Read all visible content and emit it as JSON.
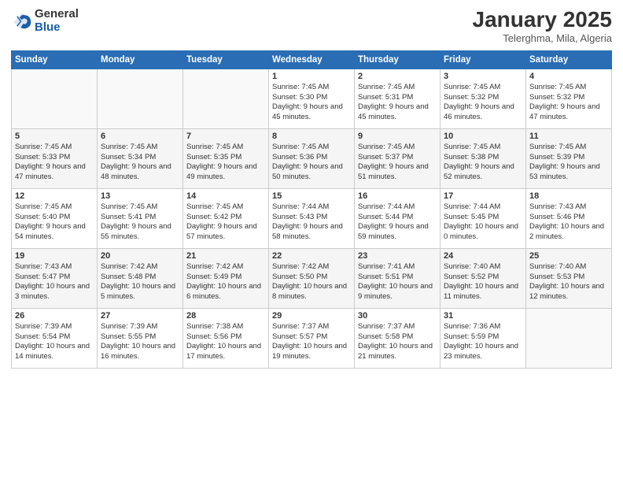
{
  "header": {
    "logo_general": "General",
    "logo_blue": "Blue",
    "title": "January 2025",
    "subtitle": "Telerghma, Mila, Algeria"
  },
  "days_of_week": [
    "Sunday",
    "Monday",
    "Tuesday",
    "Wednesday",
    "Thursday",
    "Friday",
    "Saturday"
  ],
  "weeks": [
    [
      {
        "day": "",
        "info": ""
      },
      {
        "day": "",
        "info": ""
      },
      {
        "day": "",
        "info": ""
      },
      {
        "day": "1",
        "info": "Sunrise: 7:45 AM\nSunset: 5:30 PM\nDaylight: 9 hours and 45 minutes."
      },
      {
        "day": "2",
        "info": "Sunrise: 7:45 AM\nSunset: 5:31 PM\nDaylight: 9 hours and 45 minutes."
      },
      {
        "day": "3",
        "info": "Sunrise: 7:45 AM\nSunset: 5:32 PM\nDaylight: 9 hours and 46 minutes."
      },
      {
        "day": "4",
        "info": "Sunrise: 7:45 AM\nSunset: 5:32 PM\nDaylight: 9 hours and 47 minutes."
      }
    ],
    [
      {
        "day": "5",
        "info": "Sunrise: 7:45 AM\nSunset: 5:33 PM\nDaylight: 9 hours and 47 minutes."
      },
      {
        "day": "6",
        "info": "Sunrise: 7:45 AM\nSunset: 5:34 PM\nDaylight: 9 hours and 48 minutes."
      },
      {
        "day": "7",
        "info": "Sunrise: 7:45 AM\nSunset: 5:35 PM\nDaylight: 9 hours and 49 minutes."
      },
      {
        "day": "8",
        "info": "Sunrise: 7:45 AM\nSunset: 5:36 PM\nDaylight: 9 hours and 50 minutes."
      },
      {
        "day": "9",
        "info": "Sunrise: 7:45 AM\nSunset: 5:37 PM\nDaylight: 9 hours and 51 minutes."
      },
      {
        "day": "10",
        "info": "Sunrise: 7:45 AM\nSunset: 5:38 PM\nDaylight: 9 hours and 52 minutes."
      },
      {
        "day": "11",
        "info": "Sunrise: 7:45 AM\nSunset: 5:39 PM\nDaylight: 9 hours and 53 minutes."
      }
    ],
    [
      {
        "day": "12",
        "info": "Sunrise: 7:45 AM\nSunset: 5:40 PM\nDaylight: 9 hours and 54 minutes."
      },
      {
        "day": "13",
        "info": "Sunrise: 7:45 AM\nSunset: 5:41 PM\nDaylight: 9 hours and 55 minutes."
      },
      {
        "day": "14",
        "info": "Sunrise: 7:45 AM\nSunset: 5:42 PM\nDaylight: 9 hours and 57 minutes."
      },
      {
        "day": "15",
        "info": "Sunrise: 7:44 AM\nSunset: 5:43 PM\nDaylight: 9 hours and 58 minutes."
      },
      {
        "day": "16",
        "info": "Sunrise: 7:44 AM\nSunset: 5:44 PM\nDaylight: 9 hours and 59 minutes."
      },
      {
        "day": "17",
        "info": "Sunrise: 7:44 AM\nSunset: 5:45 PM\nDaylight: 10 hours and 0 minutes."
      },
      {
        "day": "18",
        "info": "Sunrise: 7:43 AM\nSunset: 5:46 PM\nDaylight: 10 hours and 2 minutes."
      }
    ],
    [
      {
        "day": "19",
        "info": "Sunrise: 7:43 AM\nSunset: 5:47 PM\nDaylight: 10 hours and 3 minutes."
      },
      {
        "day": "20",
        "info": "Sunrise: 7:42 AM\nSunset: 5:48 PM\nDaylight: 10 hours and 5 minutes."
      },
      {
        "day": "21",
        "info": "Sunrise: 7:42 AM\nSunset: 5:49 PM\nDaylight: 10 hours and 6 minutes."
      },
      {
        "day": "22",
        "info": "Sunrise: 7:42 AM\nSunset: 5:50 PM\nDaylight: 10 hours and 8 minutes."
      },
      {
        "day": "23",
        "info": "Sunrise: 7:41 AM\nSunset: 5:51 PM\nDaylight: 10 hours and 9 minutes."
      },
      {
        "day": "24",
        "info": "Sunrise: 7:40 AM\nSunset: 5:52 PM\nDaylight: 10 hours and 11 minutes."
      },
      {
        "day": "25",
        "info": "Sunrise: 7:40 AM\nSunset: 5:53 PM\nDaylight: 10 hours and 12 minutes."
      }
    ],
    [
      {
        "day": "26",
        "info": "Sunrise: 7:39 AM\nSunset: 5:54 PM\nDaylight: 10 hours and 14 minutes."
      },
      {
        "day": "27",
        "info": "Sunrise: 7:39 AM\nSunset: 5:55 PM\nDaylight: 10 hours and 16 minutes."
      },
      {
        "day": "28",
        "info": "Sunrise: 7:38 AM\nSunset: 5:56 PM\nDaylight: 10 hours and 17 minutes."
      },
      {
        "day": "29",
        "info": "Sunrise: 7:37 AM\nSunset: 5:57 PM\nDaylight: 10 hours and 19 minutes."
      },
      {
        "day": "30",
        "info": "Sunrise: 7:37 AM\nSunset: 5:58 PM\nDaylight: 10 hours and 21 minutes."
      },
      {
        "day": "31",
        "info": "Sunrise: 7:36 AM\nSunset: 5:59 PM\nDaylight: 10 hours and 23 minutes."
      },
      {
        "day": "",
        "info": ""
      }
    ]
  ]
}
